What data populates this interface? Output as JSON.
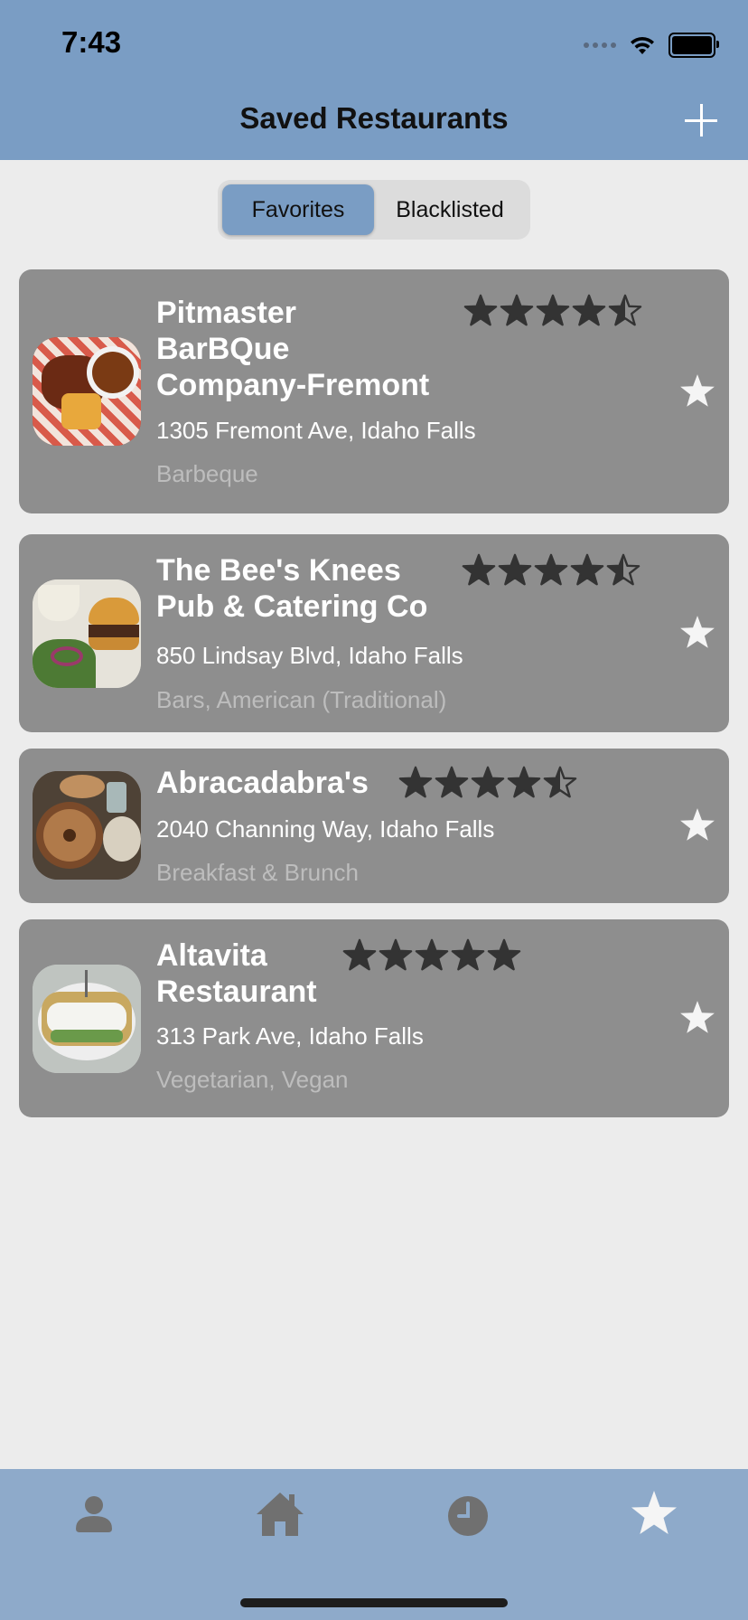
{
  "status": {
    "time": "7:43"
  },
  "header": {
    "title": "Saved Restaurants",
    "add_label": "+"
  },
  "segments": {
    "favorites": "Favorites",
    "blacklisted": "Blacklisted",
    "selected": "Favorites"
  },
  "restaurants": [
    {
      "name_lines": [
        "Pitmaster",
        "BarBQue",
        "Company-Fremont"
      ],
      "address": "1305 Fremont Ave, Idaho Falls",
      "categories": "Barbeque",
      "rating": 4.5
    },
    {
      "name_lines": [
        "The Bee's Knees",
        "Pub & Catering Co"
      ],
      "address": "850 Lindsay Blvd, Idaho Falls",
      "categories": "Bars, American (Traditional)",
      "rating": 4.5
    },
    {
      "name_lines": [
        "Abracadabra's"
      ],
      "address": "2040 Channing Way, Idaho Falls",
      "categories": "Breakfast & Brunch",
      "rating": 4.5
    },
    {
      "name_lines": [
        "Altavita",
        "Restaurant"
      ],
      "address": "313 Park Ave, Idaho Falls",
      "categories": "Vegetarian, Vegan",
      "rating": 5
    }
  ],
  "tabs": [
    "profile-icon",
    "home-icon",
    "history-icon",
    "favorites-star-icon"
  ],
  "colors": {
    "header": "#7a9dc4",
    "tabbar": "#8eaaca",
    "card": "#8e8e8e",
    "background": "#ececec",
    "star_dark": "#333333"
  }
}
